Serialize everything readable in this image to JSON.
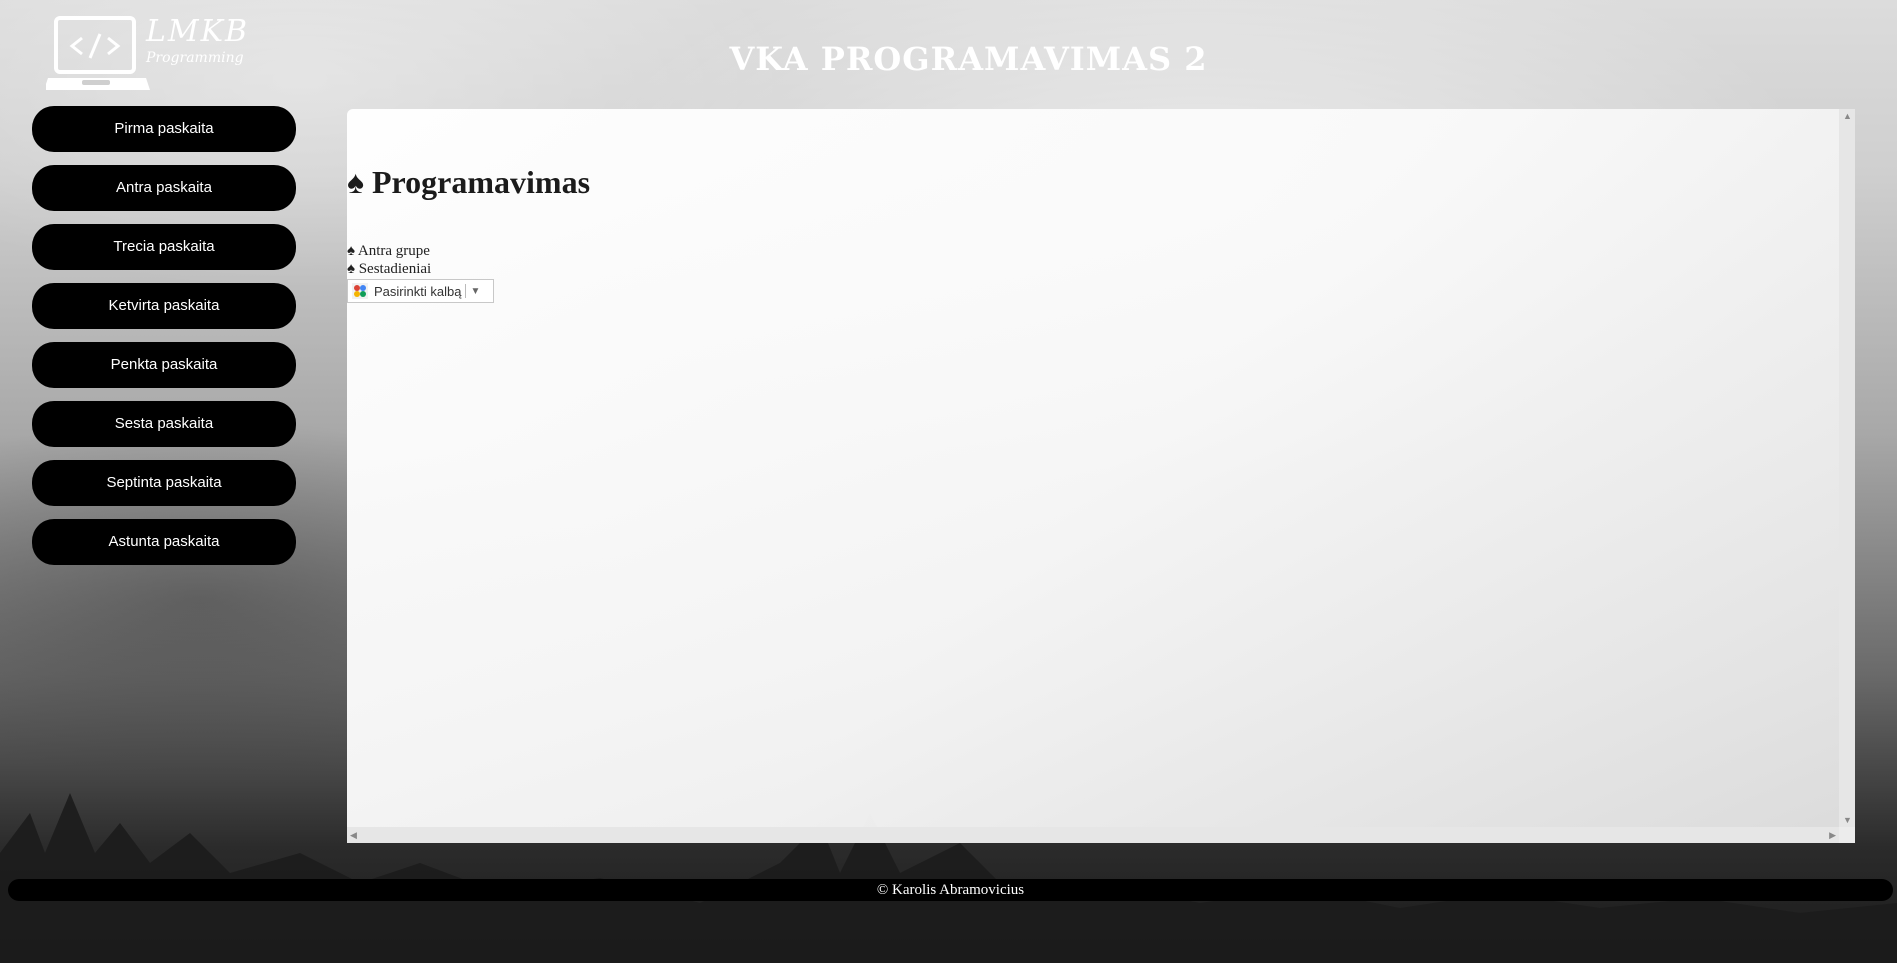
{
  "header": {
    "logo_text": "LMKB",
    "logo_subtext": "Programming",
    "site_title": "VKA PROGRAMAVIMAS 2"
  },
  "sidebar": {
    "items": [
      {
        "label": "Pirma paskaita"
      },
      {
        "label": "Antra paskaita"
      },
      {
        "label": "Trecia paskaita"
      },
      {
        "label": "Ketvirta paskaita"
      },
      {
        "label": "Penkta paskaita"
      },
      {
        "label": "Sesta paskaita"
      },
      {
        "label": "Septinta paskaita"
      },
      {
        "label": "Astunta paskaita"
      }
    ]
  },
  "main": {
    "title": "♠ Programavimas",
    "links": [
      {
        "label": "♠ Antra grupe"
      },
      {
        "label": "♠ Sestadieniai"
      }
    ],
    "translate": {
      "label": "Pasirinkti kalbą",
      "icon": "google-translate-icon"
    }
  },
  "footer": {
    "text": "© Karolis Abramovicius"
  }
}
